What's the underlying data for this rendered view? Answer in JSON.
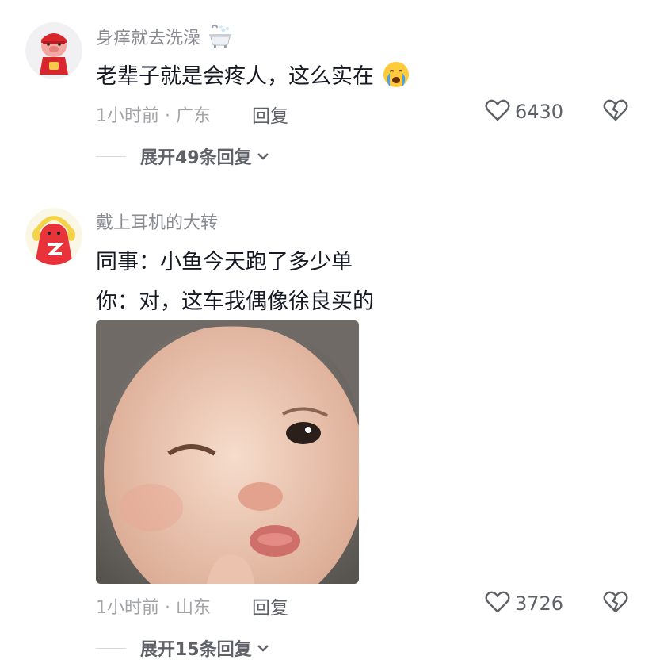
{
  "comments": [
    {
      "username": "身痒就去洗澡",
      "username_icon": "bathtub-icon",
      "text": "老辈子就是会疼人，这么实在",
      "text_emoji": "crying-face-icon",
      "time": "1小时前",
      "location": "广东",
      "reply_label": "回复",
      "likes": "6430",
      "expand_label": "展开49条回复",
      "avatar": "red-pig-avatar"
    },
    {
      "username": "戴上耳机的大转",
      "text_lines": [
        "同事：小鱼今天跑了多少单",
        "你：对，这车我偶像徐良买的"
      ],
      "image": "baby-winking-photo",
      "time": "1小时前",
      "location": "山东",
      "reply_label": "回复",
      "likes": "3726",
      "expand_label": "展开15条回复",
      "avatar": "red-mascot-avatar"
    }
  ],
  "meta_separator": "·",
  "colors": {
    "secondary_text": "#8a8b91",
    "meta_text": "#a3a4a8",
    "action_text": "#5f6168",
    "primary_text": "#161823"
  }
}
